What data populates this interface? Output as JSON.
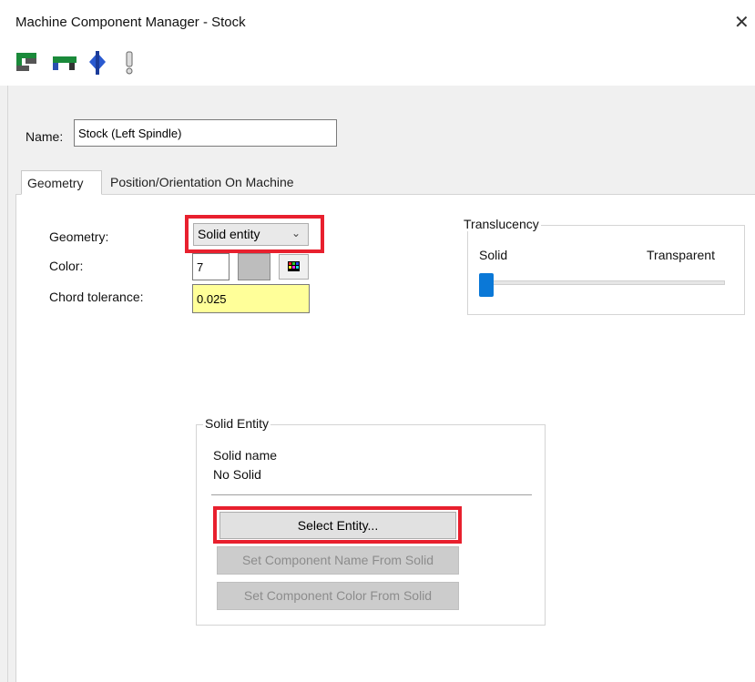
{
  "window": {
    "title": "Machine Component Manager - Stock",
    "close_glyph": "✕"
  },
  "toolbar": {
    "icons": [
      "component-icon",
      "spindle-icon",
      "tool-icon",
      "exclamation-icon"
    ]
  },
  "name_field": {
    "label": "Name:",
    "value": "Stock (Left Spindle)"
  },
  "tabs": [
    {
      "label": "Geometry",
      "active": true
    },
    {
      "label": "Position/Orientation On Machine",
      "active": false
    }
  ],
  "geometry": {
    "geometry_label": "Geometry:",
    "geometry_value": "Solid entity",
    "color_label": "Color:",
    "color_value": "7",
    "chord_label": "Chord tolerance:",
    "chord_value": "0.025"
  },
  "translucency": {
    "title": "Translucency",
    "solid_label": "Solid",
    "transparent_label": "Transparent",
    "level": 0
  },
  "solid_entity": {
    "title": "Solid Entity",
    "solid_name_label": "Solid name",
    "solid_name_value": "No Solid",
    "select_button": "Select Entity...",
    "set_name_button": "Set Component Name From Solid",
    "set_color_button": "Set Component Color From Solid"
  },
  "colors": {
    "highlight": "#e8202e",
    "chord_field_bg": "#ffff99"
  }
}
